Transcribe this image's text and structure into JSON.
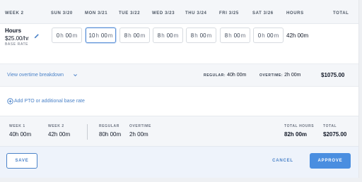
{
  "header": {
    "week": "WEEK 2",
    "days": [
      "SUN 3/20",
      "MON 3/21",
      "TUE 3/22",
      "WED 3/23",
      "THU 3/24",
      "FRI 3/25",
      "SAT 3/26"
    ],
    "hours": "HOURS",
    "total": "TOTAL"
  },
  "row": {
    "title": "Hours",
    "rate": "$25.00/hr",
    "rate_caption": "BASE RATE",
    "entries": [
      {
        "h": "0",
        "m": "00"
      },
      {
        "h": "10",
        "m": "00"
      },
      {
        "h": "8",
        "m": "00"
      },
      {
        "h": "8",
        "m": "00"
      },
      {
        "h": "8",
        "m": "00"
      },
      {
        "h": "8",
        "m": "00"
      },
      {
        "h": "0",
        "m": "00"
      }
    ],
    "h_unit": "h",
    "m_unit": "m",
    "hours_total": "42h 00m"
  },
  "overtime": {
    "link": "View overtime breakdown",
    "regular_label": "REGULAR:",
    "regular_value": "40h 00m",
    "overtime_label": "OVERTIME:",
    "overtime_value": "2h 00m",
    "total": "$1075.00"
  },
  "pto_link": "Add PTO or additional base rate",
  "summary": {
    "week1_label": "WEEK 1",
    "week1_value": "40h 00m",
    "week2_label": "WEEK 2",
    "week2_value": "42h 00m",
    "regular_label": "REGULAR",
    "regular_value": "80h 00m",
    "overtime_label": "OVERTIME",
    "overtime_value": "2h 00m",
    "total_hours_label": "TOTAL HOURS",
    "total_hours_value": "82h 00m",
    "total_label": "TOTAL",
    "total_value": "$2075.00"
  },
  "footer": {
    "save": "SAVE",
    "cancel": "CANCEL",
    "approve": "APPROVE"
  },
  "colors": {
    "accent": "#4a82c8",
    "approve_bg": "#4a8ee0",
    "header_bg": "#f4f6f9"
  },
  "icons": {
    "edit": "pencil-icon",
    "expand": "chevron-down-icon",
    "add": "plus-circle-icon"
  }
}
